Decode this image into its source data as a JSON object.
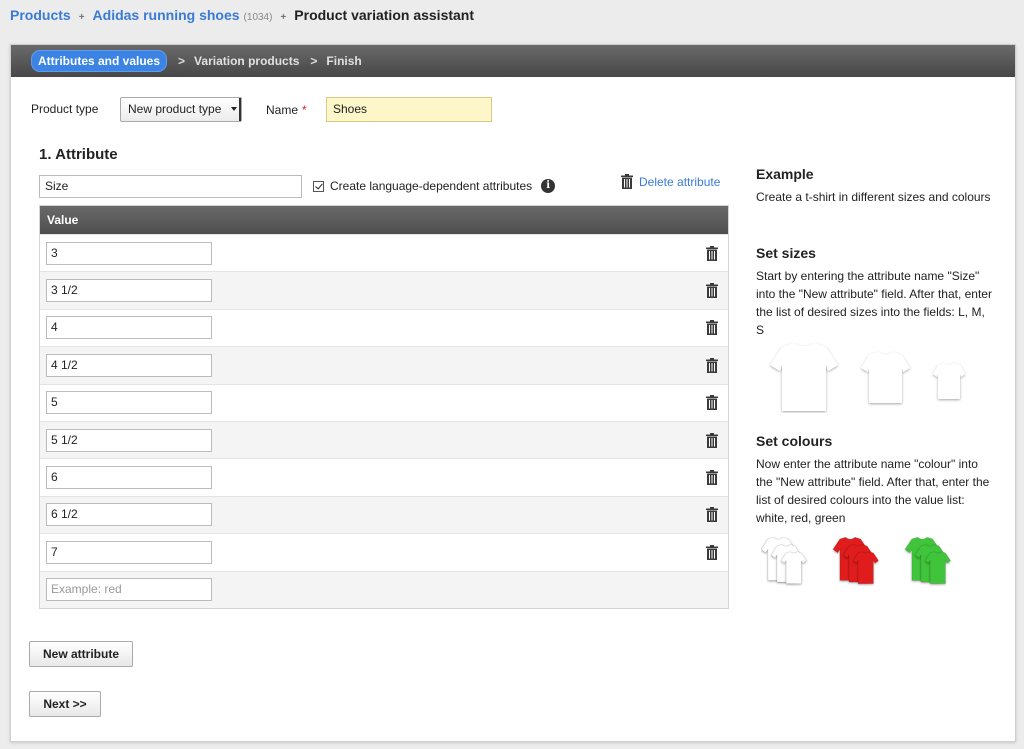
{
  "breadcrumb": {
    "products": "Products",
    "sep1": "+",
    "product": "Adidas running shoes",
    "count": "(1034)",
    "sep2": "+",
    "current": "Product variation assistant"
  },
  "steps": {
    "active": "Attributes and values",
    "sep": ">",
    "step2": "Variation products",
    "step3": "Finish"
  },
  "form": {
    "product_type_label": "Product type",
    "product_type_value": "New product type",
    "name_label": "Name",
    "required_mark": "*",
    "name_value": "Shoes"
  },
  "attribute": {
    "title": "1. Attribute",
    "name_value": "Size",
    "language_dependent_label": "Create language-dependent attributes",
    "language_dependent_checked": true,
    "delete_label": "Delete attribute",
    "value_header": "Value",
    "values": [
      "3",
      "3 1/2",
      "4",
      "4 1/2",
      "5",
      "5 1/2",
      "6",
      "6 1/2",
      "7"
    ],
    "new_value_placeholder": "Example: red"
  },
  "buttons": {
    "new_attribute": "New attribute",
    "next": "Next >>"
  },
  "help": {
    "example_title": "Example",
    "example_text": "Create a t-shirt in different sizes and colours",
    "sizes_title": "Set sizes",
    "sizes_text": "Start by entering the attribute name \"Size\" into the \"New attribute\" field. After that, enter the list of desired sizes into the fields: L, M, S",
    "colours_title": "Set colours",
    "colours_text": "Now enter the attribute name \"colour\" into the \"New attribute\" field. After that, enter the list of desired colours into the value list: white, red, green"
  },
  "colors": {
    "link": "#3a7bd5",
    "active_step": "#3b84e3",
    "name_field_bg": "#fcf6c8",
    "shirt_red": "#e01b1b",
    "shirt_green": "#3fc43a"
  },
  "icons": {
    "trash": "trash-icon",
    "info": "info-icon",
    "dropdown": "chevron-down-icon",
    "checkbox": "checkbox-checked-icon"
  }
}
